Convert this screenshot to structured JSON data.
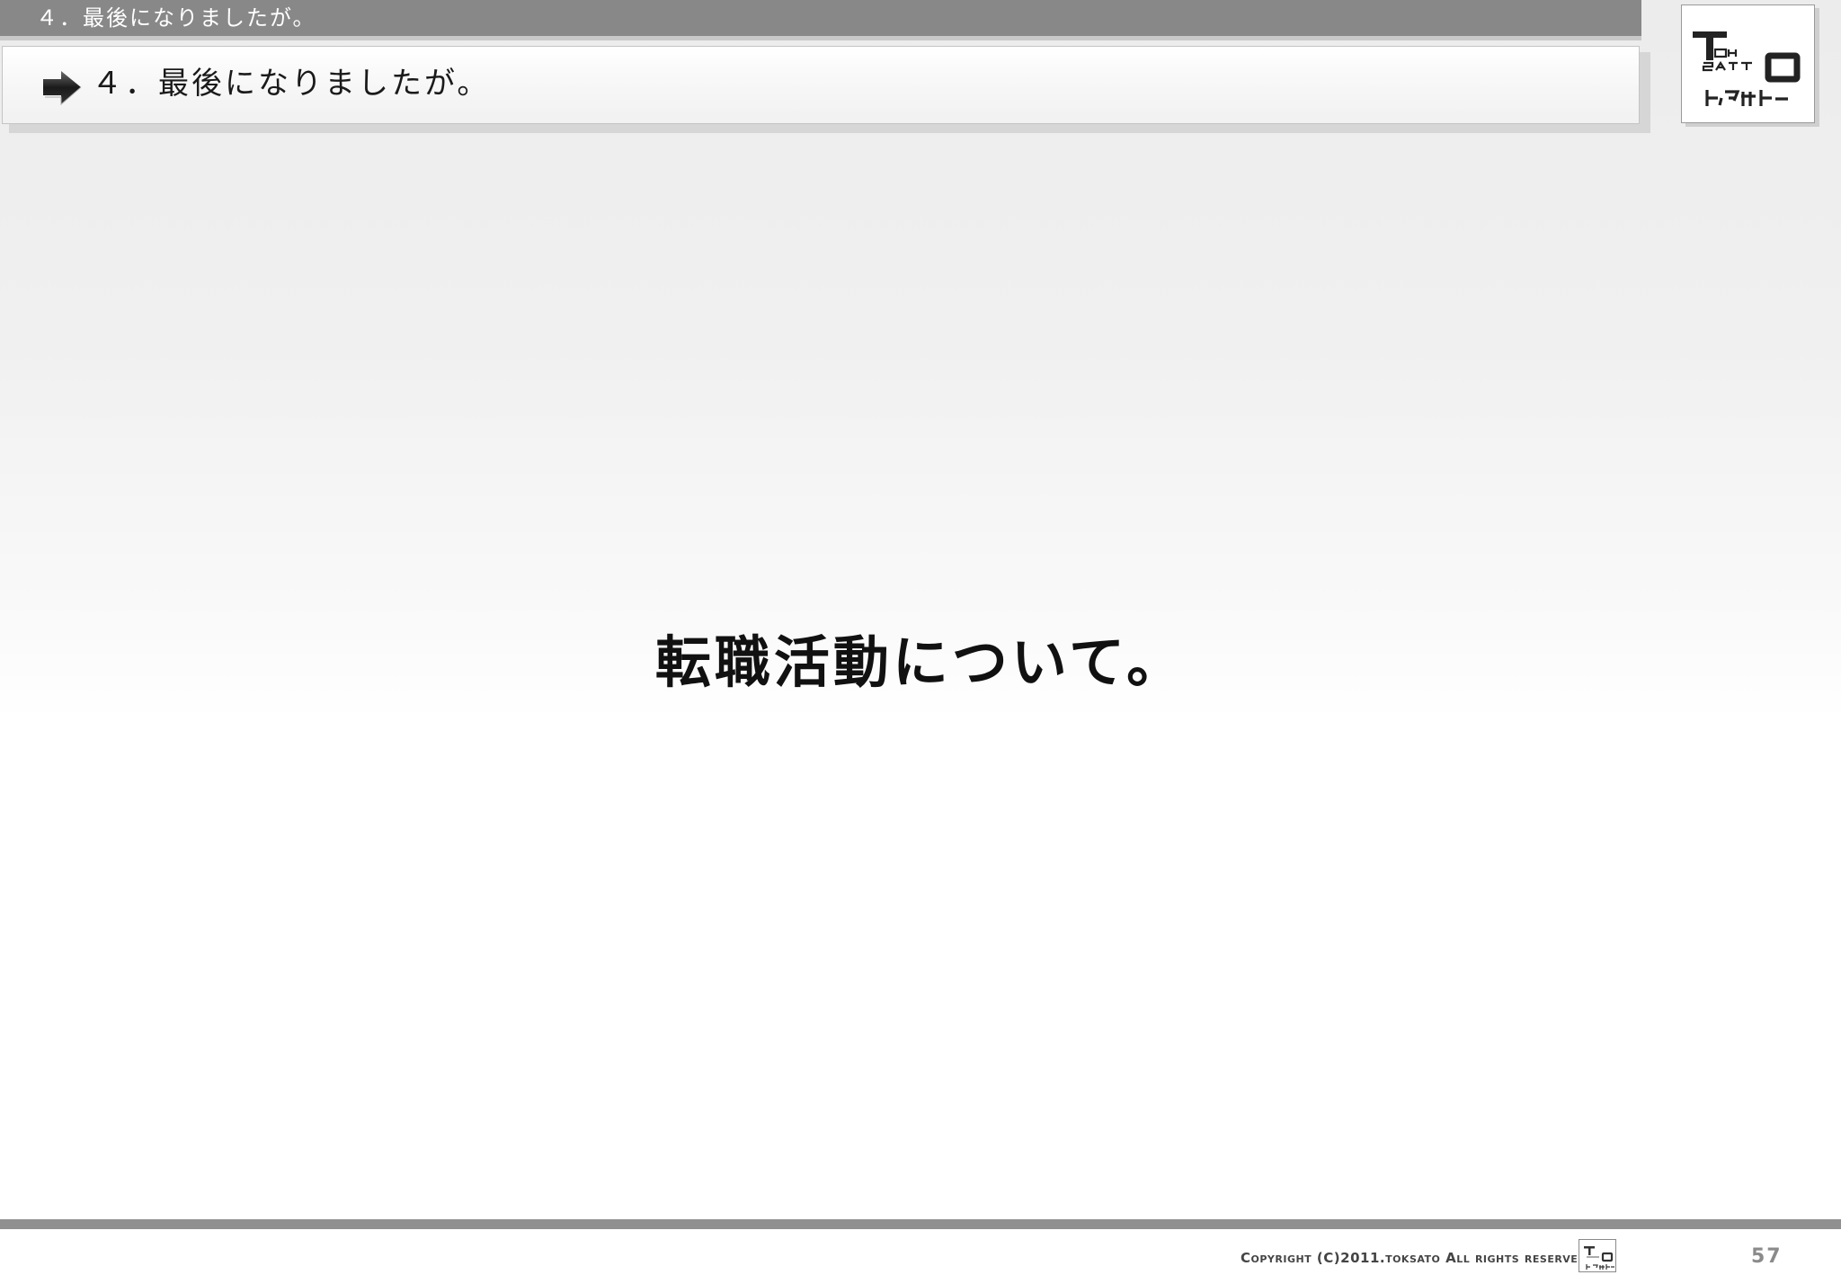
{
  "header": {
    "section_label": "４．最後になりましたが。"
  },
  "title_box": {
    "title": "４．最後になりましたが。",
    "arrow_icon": "arrow-right-icon"
  },
  "logo": {
    "line1": "T OH",
    "line2": "SAT O",
    "line3": "トクサト"
  },
  "main": {
    "heading": "転職活動について。"
  },
  "footer": {
    "copyright": "Copyright (C)2011.toksato All rights reserved.",
    "page_number": "57"
  },
  "colors": {
    "top_bar": "#888888",
    "bottom_bar": "#909090",
    "text": "#111111"
  }
}
